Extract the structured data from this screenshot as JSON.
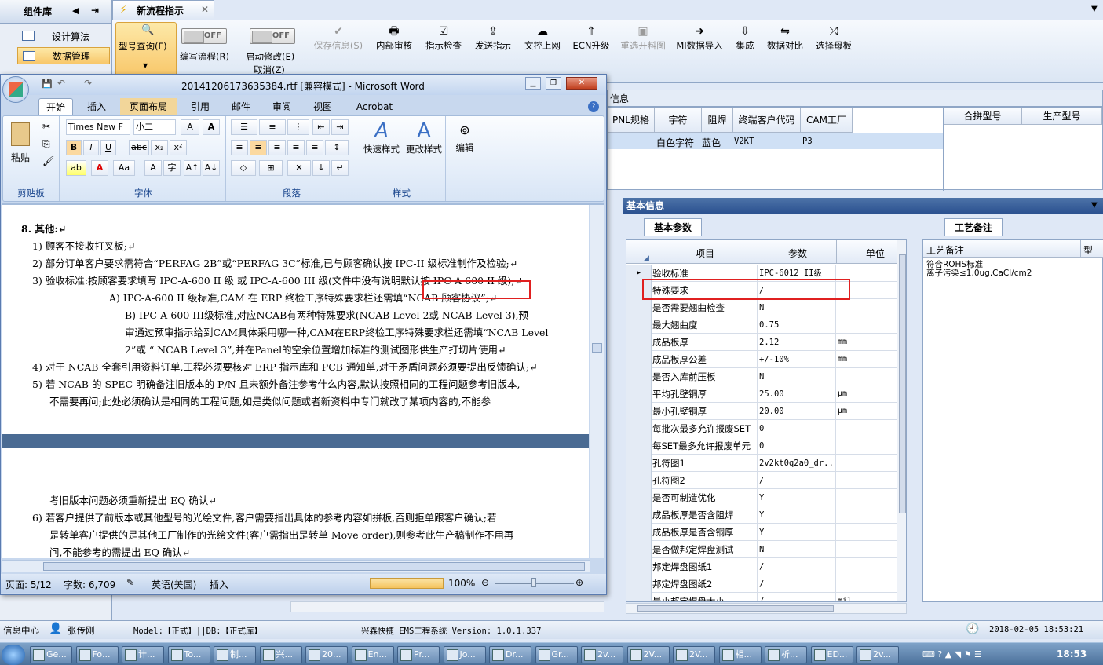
{
  "left_nav": {
    "title": "组件库",
    "items": [
      "设计算法",
      "数据管理"
    ]
  },
  "top_tab": {
    "label": "新流程指示"
  },
  "ribbon": {
    "buttons": [
      {
        "label": "型号查询(F)",
        "icon": "search-icon",
        "enabled": true
      },
      {
        "label": "编写流程(R)",
        "icon": "toggle",
        "enabled": true
      },
      {
        "label": "启动修改(E)",
        "icon": "toggle",
        "enabled": true
      },
      {
        "label": "保存信息(S)",
        "icon": "check-icon",
        "enabled": false
      },
      {
        "label": "内部审核",
        "icon": "print-icon",
        "enabled": true
      },
      {
        "label": "指示检查",
        "icon": "checkbox-icon",
        "enabled": true
      },
      {
        "label": "发送指示",
        "icon": "upload-icon",
        "enabled": true
      },
      {
        "label": "文控上网",
        "icon": "cloud-icon",
        "enabled": true
      },
      {
        "label": "ECN升级",
        "icon": "arrows-icon",
        "enabled": true
      },
      {
        "label": "重选开料图",
        "icon": "image-icon",
        "enabled": false
      },
      {
        "label": "MI数据导入",
        "icon": "import-icon",
        "enabled": true
      },
      {
        "label": "集成",
        "icon": "download-icon",
        "enabled": true
      },
      {
        "label": "数据对比",
        "icon": "compare-icon",
        "enabled": true
      },
      {
        "label": "选择母板",
        "icon": "shuffle-icon",
        "enabled": true
      }
    ],
    "toggle_text": "OFF",
    "cancel_label": "取消(Z)"
  },
  "top_grid": {
    "section_label": "信息",
    "headers": [
      "PNL规格",
      "字符",
      "阻焊",
      "终端客户代码",
      "CAM工厂"
    ],
    "row": [
      "",
      "白色字符",
      "蓝色",
      "V2KT",
      "P3"
    ],
    "right_headers": [
      "合拼型号",
      "生产型号"
    ]
  },
  "basic_info": {
    "title": "基本信息",
    "tab": "基本参数",
    "columns": [
      "项目",
      "参数",
      "单位"
    ],
    "rows": [
      [
        "验收标准",
        "IPC-6012 II级",
        ""
      ],
      [
        "特殊要求",
        "/",
        ""
      ],
      [
        "是否需要翘曲检查",
        "N",
        ""
      ],
      [
        "最大翘曲度",
        "0.75",
        ""
      ],
      [
        "成品板厚",
        "2.12",
        "mm"
      ],
      [
        "成品板厚公差",
        "+/-10%",
        "mm"
      ],
      [
        "是否入库前压板",
        "N",
        ""
      ],
      [
        "平均孔壁铜厚",
        "25.00",
        "μm"
      ],
      [
        "最小孔壁铜厚",
        "20.00",
        "μm"
      ],
      [
        "每批次最多允许报废SET",
        "0",
        ""
      ],
      [
        "每SET最多允许报废单元",
        "0",
        ""
      ],
      [
        "孔符图1",
        "2v2kt0q2a0_dr...",
        ""
      ],
      [
        "孔符图2",
        "/",
        ""
      ],
      [
        "是否可制造优化",
        "Y",
        ""
      ],
      [
        "成品板厚是否含阻焊",
        "Y",
        ""
      ],
      [
        "成品板厚是否含铜厚",
        "Y",
        ""
      ],
      [
        "是否做邦定焊盘测试",
        "N",
        ""
      ],
      [
        "邦定焊盘图纸1",
        "/",
        ""
      ],
      [
        "邦定焊盘图纸2",
        "/",
        ""
      ],
      [
        "最小邦定焊盘大小",
        "/",
        "mil"
      ]
    ]
  },
  "craft_notes": {
    "tab": "工艺备注",
    "col1": "工艺备注",
    "col2": "型",
    "lines": [
      "符合ROHS标准",
      "离子污染≤1.0ug.CaCl/cm2"
    ]
  },
  "word": {
    "title": "20141206173635384.rtf [兼容模式] - Microsoft Word",
    "tabs": [
      "开始",
      "插入",
      "页面布局",
      "引用",
      "邮件",
      "审阅",
      "视图",
      "Acrobat"
    ],
    "font_name": "Times New F",
    "font_size": "小二",
    "groups": [
      "剪贴板",
      "字体",
      "段落",
      "样式",
      "编辑"
    ],
    "paste": "粘贴",
    "quick_style": "快速样式",
    "change_style": "更改样式",
    "edit": "编辑",
    "doc_lines": [
      "8.  其他:↵",
      "1)  顾客不接收打叉板;↵",
      "2)  部分订单客户要求需符合“PERFAG 2B”或“PERFAG 3C”标准,已与顾客确认按 IPC-II 级标准制作及检验;↵",
      "3)  验收标准:按顾客要求填写 IPC-A-600 II 级 或 IPC-A-600 III 级(文件中没有说明默认按 IPC-A-600 II 级);↵",
      "A)  IPC-A-600 II 级标准,CAM 在 ERP 终检工序特殊要求栏还需填“NCAB 顾客协议”;↵",
      "B) IPC-A-600 III级标准,对应NCAB有两种特殊要求(NCAB Level 2或 NCAB Level 3),预",
      "审通过预审指示给到CAM具体采用哪一种,CAM在ERP终检工序特殊要求栏还需填“NCAB Level",
      "2”或 “ NCAB Level 3”,并在Panel的空余位置增加标准的测试图形供生产打切片使用↵",
      "4)  对于 NCAB 全套引用资料订单,工程必须要核对 ERP 指示库和 PCB 通知单,对于矛盾问题必须要提出反馈确认;↵",
      "5)  若 NCAB 的 SPEC 明确备注旧版本的 P/N 且未额外备注参考什么内容,默认按照相同的工程问题参考旧版本,",
      "不需要再问;此处必须确认是相同的工程问题,如是类似问题或者新资料中专门就改了某项内容的,不能参",
      "考旧版本问题必须重新提出 EQ 确认↵",
      "6)  若客户提供了前版本或其他型号的光绘文件,客户需要指出具体的参考内容如拼板,否则拒单跟客户确认;若",
      "是转单客户提供的是其他工厂制作的光绘文件(客户需指出是转单 Move order),则参考此生产稿制作不用再",
      "问,不能参考的需提出 EQ 确认↵"
    ],
    "status": {
      "page": "页面: 5/12",
      "words": "字数: 6,709",
      "lang": "英语(美国)",
      "mode": "插入",
      "zoom": "100%"
    }
  },
  "status_bar": {
    "info": "信息中心",
    "user": "张传刚",
    "model": "Model:【正式】||DB:【正式库】",
    "system": "兴森快捷 EMS工程系统 Version: 1.0.1.337",
    "datetime": "2018-02-05 18:53:21"
  },
  "taskbar": {
    "items": [
      "Ge...",
      "Fo...",
      "计...",
      "To...",
      "制...",
      "兴...",
      "20...",
      "En...",
      "Pr...",
      "Jo...",
      "Dr...",
      "Gr...",
      "2v...",
      "2V...",
      "2V...",
      "相...",
      "析...",
      "ED...",
      "2v..."
    ],
    "time": "18:53"
  }
}
